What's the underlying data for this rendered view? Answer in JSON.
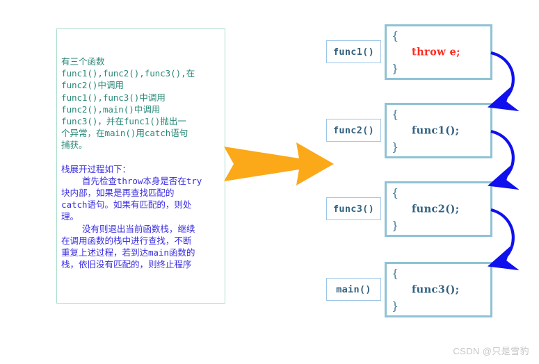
{
  "explanation": {
    "paragraph_1": "有三个函数\nfunc1(),func2(),func3(),在\nfunc2()中调用\nfunc1(),func3()中调用\nfunc2(),main()中调用\nfunc3()，并在func1()抛出一\n个异常，在main()用catch语句\n捕获。",
    "paragraph_2": "栈展开过程如下：\n    首先检查throw本身是否在try\n块内部，如果是再查找匹配的\ncatch语句。如果有匹配的，则处\n理。\n    没有则退出当前函数栈，继续\n在调用函数的栈中进行查找，不断\n重复上述过程，若到达main函数的\n栈，依旧没有匹配的，则终止程序",
    "border_color": "#a9ddc8",
    "paragraph_1_color": "#2a8a78",
    "paragraph_2_color": "#3b2fe0"
  },
  "big_arrow": {
    "icon": "right-arrow-icon",
    "color": "#FBA919"
  },
  "call_stack": {
    "frames": [
      {
        "label": "func1()",
        "open_brace": "{",
        "code": "throw e;",
        "close_brace": "}",
        "code_kind": "throw",
        "code_color": "#ff2a20"
      },
      {
        "label": "func2()",
        "open_brace": "{",
        "code": "func1();",
        "close_brace": "}",
        "code_kind": "call",
        "code_color": "#33617f"
      },
      {
        "label": "func3()",
        "open_brace": "{",
        "code": "func2();",
        "close_brace": "}",
        "code_kind": "call",
        "code_color": "#33617f"
      },
      {
        "label": "main()",
        "open_brace": "{",
        "code": "func3();",
        "close_brace": "}",
        "code_kind": "call",
        "code_color": "#33617f"
      }
    ],
    "code_border_color": "#8fc2d4",
    "label_border_color": "#9cc6e8",
    "connector_color": "#1010ee"
  },
  "watermark": {
    "text": "CSDN @只是雪豹",
    "color": "#c6c6c6"
  }
}
